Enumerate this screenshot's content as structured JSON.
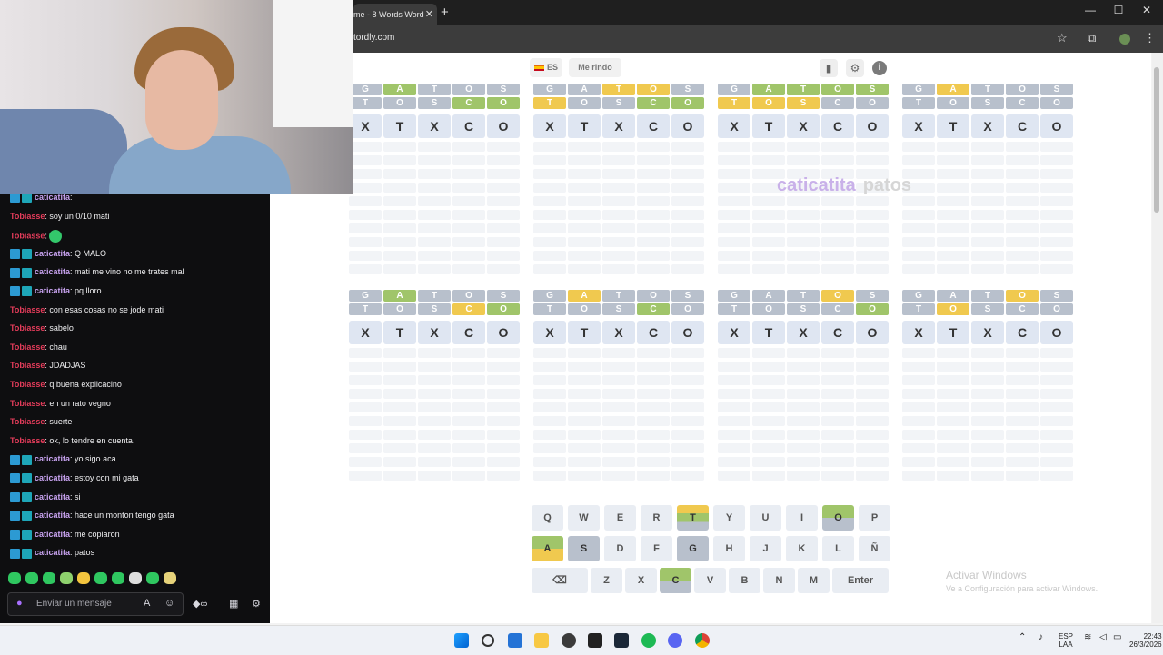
{
  "browser": {
    "tab_title": "me - 8 Words Word",
    "tab_close": "✕",
    "new_tab": "+",
    "url": "tordly.com",
    "minimize": "—",
    "maximize": "☐",
    "close": "✕"
  },
  "header": {
    "lang": "ES",
    "give_up": "Me rindo"
  },
  "guesses": [
    "GATOS",
    "TOSCO"
  ],
  "current_word": "XTXCO",
  "boards": [
    {
      "colors": [
        [
          "n",
          "g",
          "n",
          "n",
          "n"
        ],
        [
          "n",
          "n",
          "n",
          "g",
          "g"
        ]
      ]
    },
    {
      "colors": [
        [
          "n",
          "n",
          "y",
          "y",
          "n"
        ],
        [
          "y",
          "n",
          "n",
          "g",
          "g"
        ]
      ]
    },
    {
      "colors": [
        [
          "n",
          "g",
          "g",
          "g",
          "g"
        ],
        [
          "y",
          "y",
          "y",
          "n",
          "n"
        ]
      ]
    },
    {
      "colors": [
        [
          "n",
          "y",
          "n",
          "n",
          "n"
        ],
        [
          "n",
          "n",
          "n",
          "n",
          "n"
        ]
      ]
    },
    {
      "colors": [
        [
          "n",
          "g",
          "n",
          "n",
          "n"
        ],
        [
          "n",
          "n",
          "n",
          "y",
          "g"
        ]
      ]
    },
    {
      "colors": [
        [
          "n",
          "y",
          "n",
          "n",
          "n"
        ],
        [
          "n",
          "n",
          "n",
          "g",
          "n"
        ]
      ]
    },
    {
      "colors": [
        [
          "n",
          "n",
          "n",
          "y",
          "n"
        ],
        [
          "n",
          "n",
          "n",
          "n",
          "g"
        ]
      ]
    },
    {
      "colors": [
        [
          "n",
          "n",
          "n",
          "y",
          "n"
        ],
        [
          "n",
          "y",
          "n",
          "n",
          "n"
        ]
      ]
    }
  ],
  "overlay": {
    "user": "caticatita",
    "message": "patos"
  },
  "keyboard": {
    "row1": [
      "Q",
      "W",
      "E",
      "R",
      "T",
      "Y",
      "U",
      "I",
      "O",
      "P"
    ],
    "row2": [
      "A",
      "S",
      "D",
      "F",
      "G",
      "H",
      "J",
      "K",
      "L",
      "Ñ"
    ],
    "row3": [
      "⌫",
      "Z",
      "X",
      "C",
      "V",
      "B",
      "N",
      "M",
      "Enter"
    ]
  },
  "watermark": {
    "title": "Activar Windows",
    "subtitle": "Ve a Configuración para activar Windows."
  },
  "chat": {
    "messages": [
      {
        "user": "caticatita",
        "text": "",
        "badges": true,
        "emote": false
      },
      {
        "user": "Tobiasse",
        "text": "soy un 0/10 mati",
        "badges": false,
        "emote": false
      },
      {
        "user": "Tobiasse",
        "text": "",
        "badges": false,
        "emote": true
      },
      {
        "user": "caticatita",
        "text": "Q MALO",
        "badges": true,
        "emote": false
      },
      {
        "user": "caticatita",
        "text": "mati me vino no me trates mal",
        "badges": true,
        "emote": false
      },
      {
        "user": "caticatita",
        "text": "pq lloro",
        "badges": true,
        "emote": false
      },
      {
        "user": "Tobiasse",
        "text": "con esas cosas no se jode mati",
        "badges": false,
        "emote": false
      },
      {
        "user": "Tobiasse",
        "text": "sabelo",
        "badges": false,
        "emote": false
      },
      {
        "user": "Tobiasse",
        "text": "chau",
        "badges": false,
        "emote": false
      },
      {
        "user": "Tobiasse",
        "text": "JDADJAS",
        "badges": false,
        "emote": false
      },
      {
        "user": "Tobiasse",
        "text": "q buena explicacino",
        "badges": false,
        "emote": false
      },
      {
        "user": "Tobiasse",
        "text": "en un rato vegno",
        "badges": false,
        "emote": false
      },
      {
        "user": "Tobiasse",
        "text": "suerte",
        "badges": false,
        "emote": false
      },
      {
        "user": "Tobiasse",
        "text": "ok, lo tendre en cuenta.",
        "badges": false,
        "emote": false
      },
      {
        "user": "caticatita",
        "text": "yo sigo aca",
        "badges": true,
        "emote": false
      },
      {
        "user": "caticatita",
        "text": "estoy con mi gata",
        "badges": true,
        "emote": false
      },
      {
        "user": "caticatita",
        "text": "si",
        "badges": true,
        "emote": false
      },
      {
        "user": "caticatita",
        "text": "hace un monton tengo gata",
        "badges": true,
        "emote": false
      },
      {
        "user": "caticatita",
        "text": "me copiaron",
        "badges": true,
        "emote": false
      },
      {
        "user": "caticatita",
        "text": "patos",
        "badges": true,
        "emote": false
      }
    ],
    "input_placeholder": "Enviar un mensaje"
  },
  "taskbar": {
    "lang": "ESP",
    "lang_sub": "LAA",
    "time": "22:43",
    "date": "26/3/2026"
  }
}
